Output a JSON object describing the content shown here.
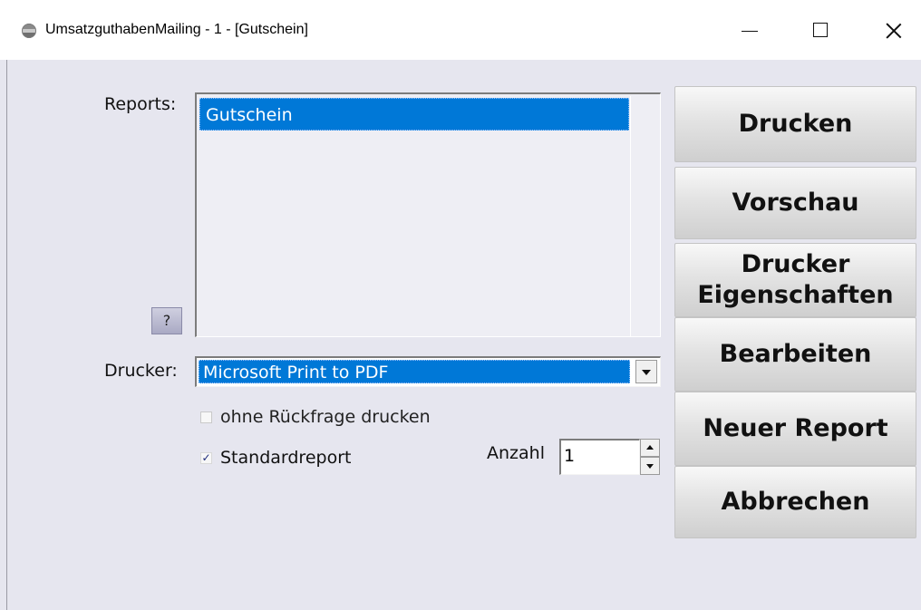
{
  "window": {
    "title": "UmsatzguthabenMailing - 1 - [Gutschein]"
  },
  "labels": {
    "reports": "Reports:",
    "drucker": "Drucker:",
    "anzahl": "Anzahl"
  },
  "reports_list": {
    "items": [
      "Gutschein"
    ],
    "selected_index": 0
  },
  "help_button": "?",
  "printer_select": {
    "selected": "Microsoft Print to PDF"
  },
  "options": {
    "ohne_rueckfrage": {
      "label": "ohne Rückfrage drucken",
      "checked": false,
      "enabled": false
    },
    "standardreport": {
      "label": "Standardreport",
      "checked": true,
      "check_glyph": "✓"
    }
  },
  "anzahl_value": "1",
  "buttons": {
    "drucken": "Drucken",
    "vorschau": "Vorschau",
    "drucker_eigenschaften": "Drucker\nEigenschaften",
    "bearbeiten": "Bearbeiten",
    "neuer_report": "Neuer Report",
    "abbrechen": "Abbrechen"
  },
  "colors": {
    "selection": "#0078d7",
    "background": "#e6e6ef"
  }
}
